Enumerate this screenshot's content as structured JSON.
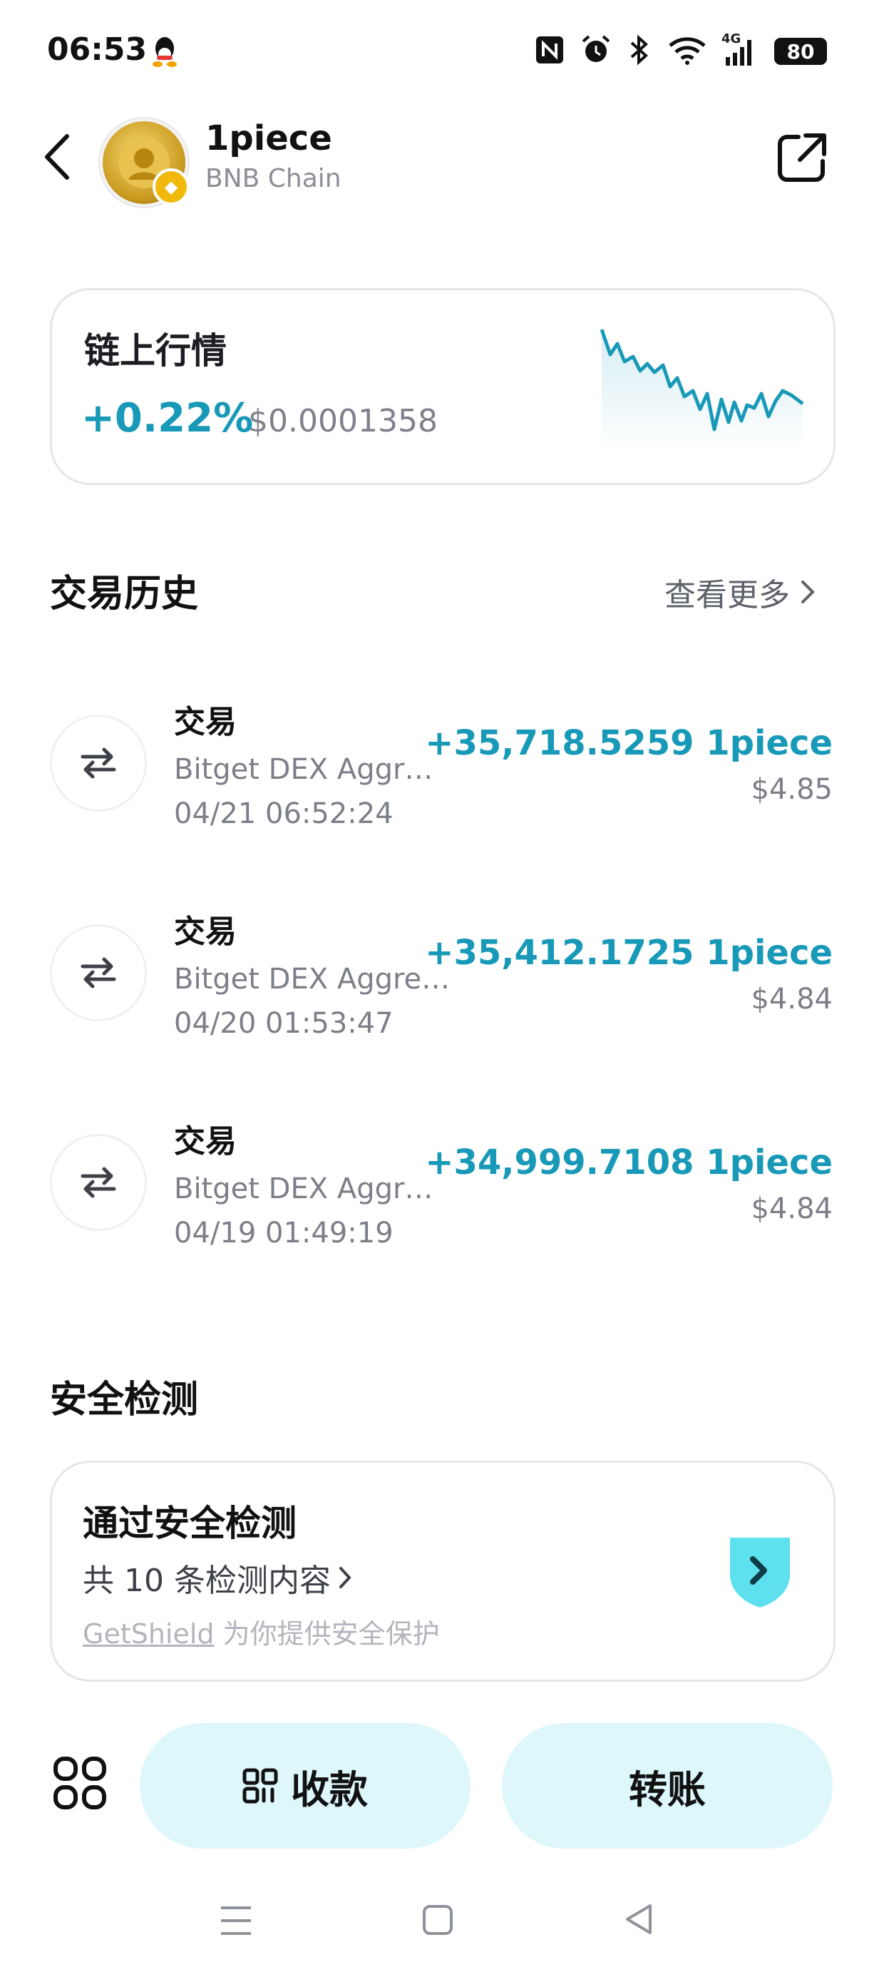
{
  "status_bar": {
    "time": "06:53",
    "network": "4G",
    "battery": "80"
  },
  "header": {
    "token_name": "1piece",
    "chain": "BNB Chain"
  },
  "market": {
    "title": "链上行情",
    "change": "+0.22%",
    "price": "$0.0001358",
    "accent": "#1899b8"
  },
  "history": {
    "title": "交易历史",
    "more": "查看更多",
    "items": [
      {
        "type": "交易",
        "source": "Bitget DEX Aggr…",
        "time": "04/21 06:52:24",
        "amount": "+35,718.5259 1piece",
        "usd": "$4.85"
      },
      {
        "type": "交易",
        "source": "Bitget DEX Aggre…",
        "time": "04/20 01:53:47",
        "amount": "+35,412.1725 1piece",
        "usd": "$4.84"
      },
      {
        "type": "交易",
        "source": "Bitget DEX Aggr…",
        "time": "04/19 01:49:19",
        "amount": "+34,999.7108 1piece",
        "usd": "$4.84"
      }
    ]
  },
  "security": {
    "title": "安全检测",
    "card_title": "通过安全检测",
    "count_text": "共 10 条检测内容",
    "provider_name": "GetShield",
    "provider_suffix": " 为你提供安全保护"
  },
  "actions": {
    "receive": "收款",
    "transfer": "转账"
  }
}
